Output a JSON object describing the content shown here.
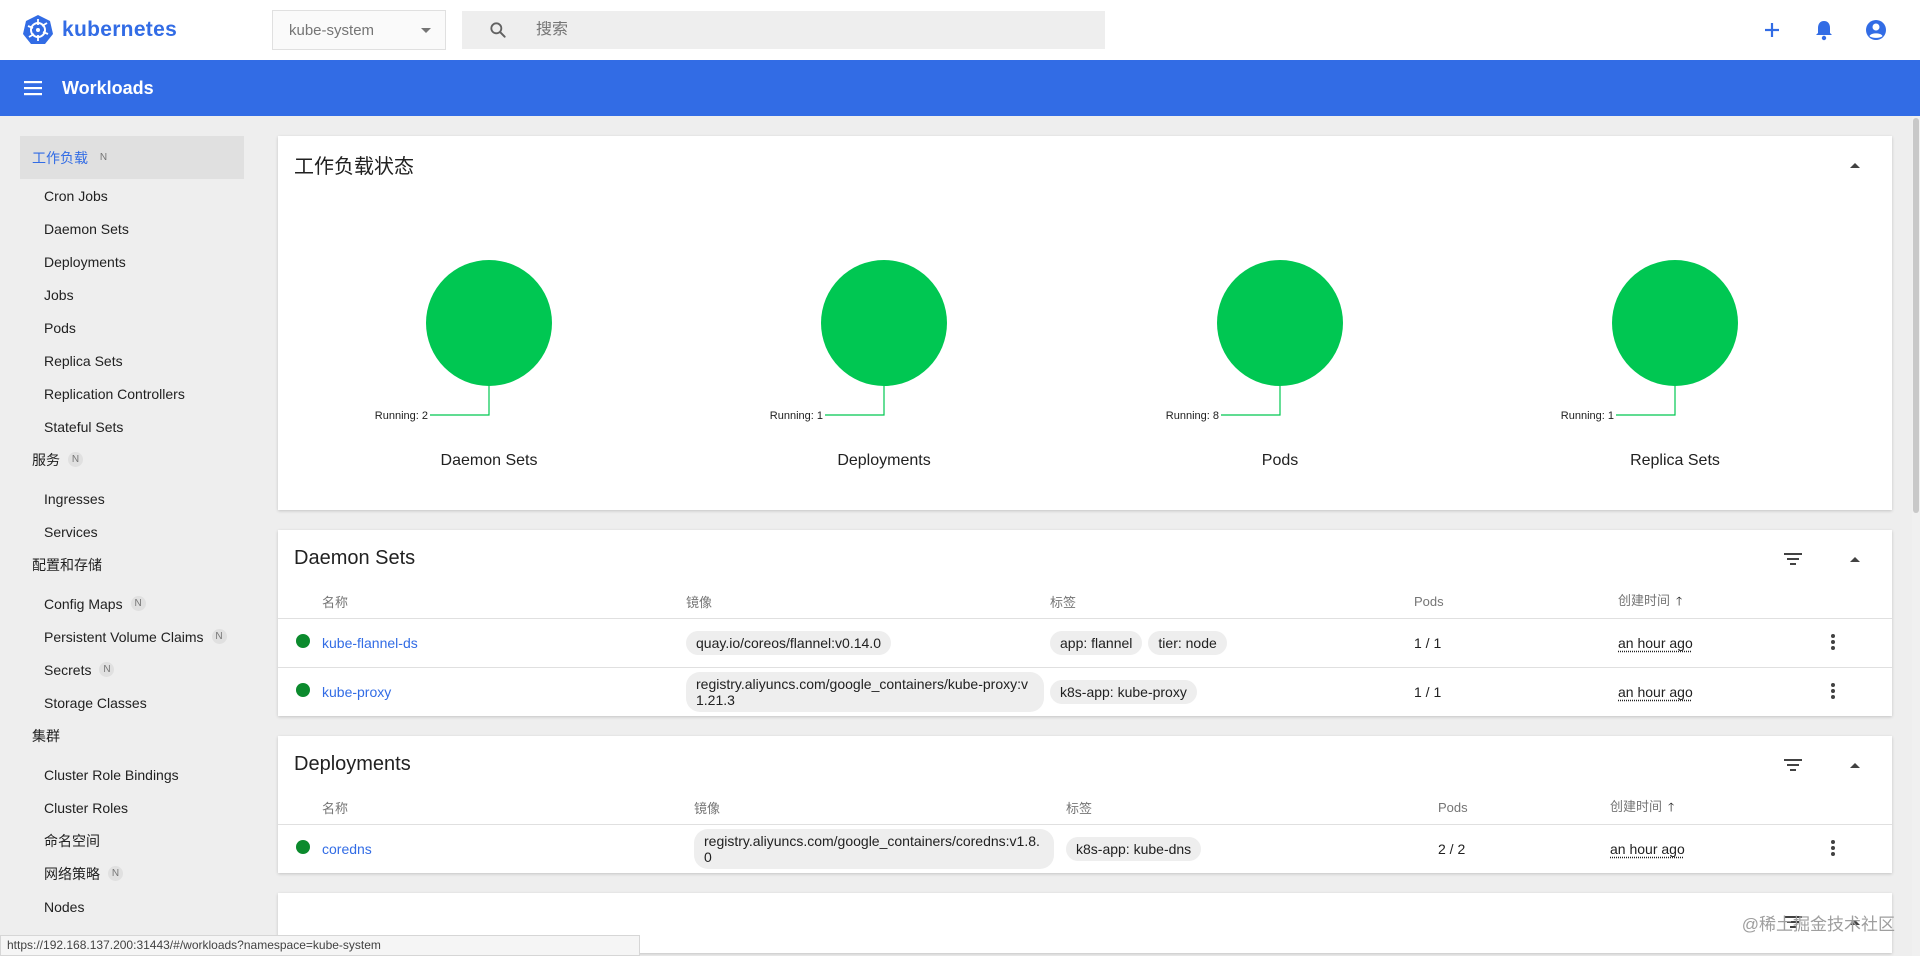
{
  "brand": {
    "name": "kubernetes",
    "color": "#326ce5"
  },
  "namespace": {
    "selected": "kube-system"
  },
  "search": {
    "placeholder": "搜索"
  },
  "appbar": {
    "title": "Workloads"
  },
  "sidebar": {
    "sections": [
      {
        "label": "工作负载",
        "badge": "N",
        "items": [
          {
            "label": "Cron Jobs"
          },
          {
            "label": "Daemon Sets"
          },
          {
            "label": "Deployments"
          },
          {
            "label": "Jobs"
          },
          {
            "label": "Pods"
          },
          {
            "label": "Replica Sets"
          },
          {
            "label": "Replication Controllers"
          },
          {
            "label": "Stateful Sets"
          }
        ]
      },
      {
        "label": "服务",
        "badge": "N",
        "items": [
          {
            "label": "Ingresses"
          },
          {
            "label": "Services"
          }
        ]
      },
      {
        "label": "配置和存储",
        "items": [
          {
            "label": "Config Maps",
            "badge": "N"
          },
          {
            "label": "Persistent Volume Claims",
            "badge": "N"
          },
          {
            "label": "Secrets",
            "badge": "N"
          },
          {
            "label": "Storage Classes"
          }
        ]
      },
      {
        "label": "集群",
        "items": [
          {
            "label": "Cluster Role Bindings"
          },
          {
            "label": "Cluster Roles"
          },
          {
            "label": "命名空间"
          },
          {
            "label": "网络策略",
            "badge": "N"
          },
          {
            "label": "Nodes"
          }
        ]
      }
    ]
  },
  "status_card": {
    "title": "工作负载状态",
    "charts": [
      {
        "label": "Daemon Sets",
        "annotation": "Running: 2",
        "running": 2
      },
      {
        "label": "Deployments",
        "annotation": "Running: 1",
        "running": 1
      },
      {
        "label": "Pods",
        "annotation": "Running: 8",
        "running": 8
      },
      {
        "label": "Replica Sets",
        "annotation": "Running: 1",
        "running": 1
      }
    ],
    "running_color": "#00c752"
  },
  "daemon_sets": {
    "title": "Daemon Sets",
    "columns": [
      "名称",
      "镜像",
      "标签",
      "Pods",
      "创建时间"
    ],
    "rows": [
      {
        "name": "kube-flannel-ds",
        "image": "quay.io/coreos/flannel:v0.14.0",
        "labels": [
          "app: flannel",
          "tier: node"
        ],
        "pods": "1 / 1",
        "created": "an hour ago"
      },
      {
        "name": "kube-proxy",
        "image": "registry.aliyuncs.com/google_containers/kube-proxy:v1.21.3",
        "labels": [
          "k8s-app: kube-proxy"
        ],
        "pods": "1 / 1",
        "created": "an hour ago"
      }
    ]
  },
  "deployments": {
    "title": "Deployments",
    "columns": [
      "名称",
      "镜像",
      "标签",
      "Pods",
      "创建时间"
    ],
    "rows": [
      {
        "name": "coredns",
        "image": "registry.aliyuncs.com/google_containers/coredns:v1.8.0",
        "labels": [
          "k8s-app: kube-dns"
        ],
        "pods": "2 / 2",
        "created": "an hour ago"
      }
    ]
  },
  "statusbar": {
    "url": "https://192.168.137.200:31443/#/workloads?namespace=kube-system"
  },
  "watermark": "@稀土掘金技术社区",
  "status_color": "#0b8a2d"
}
